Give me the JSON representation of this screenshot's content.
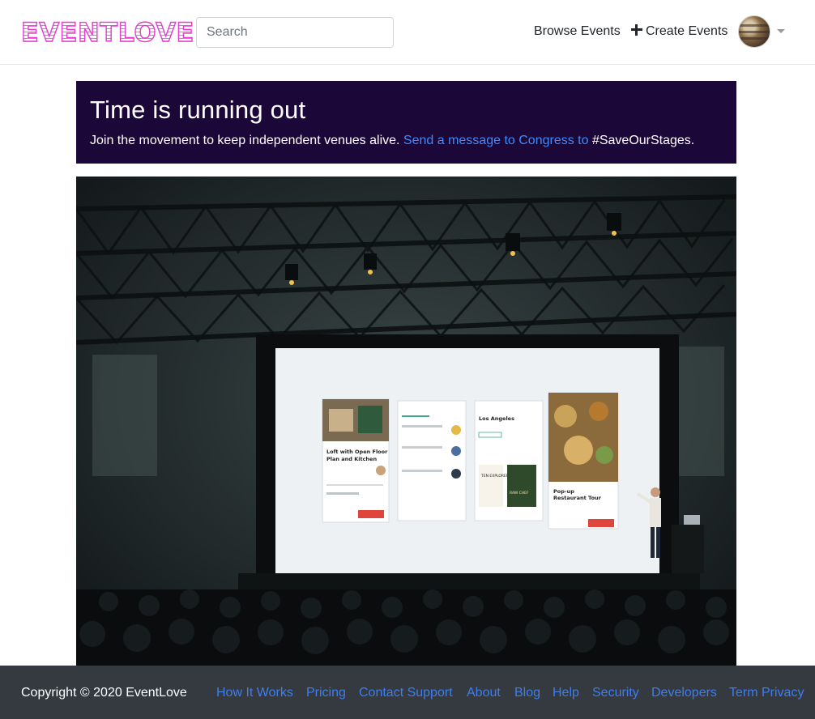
{
  "navbar": {
    "logo_text": "EVENTLOVE",
    "search_placeholder": "Search",
    "browse_label": "Browse Events",
    "create_label": "Create Events"
  },
  "banner": {
    "title": "Time is running out",
    "text_before": "Join the movement to keep independent venues alive. ",
    "link_text": "Send a message to Congress to",
    "text_after": " #SaveOurStages."
  },
  "hero": {
    "screen_cards": {
      "card1_title_line1": "Loft with Open Floor",
      "card1_title_line2": "Plan and Kitchen",
      "card3_title": "Los Angeles",
      "card3_poster1": "TEN EXPLORERS",
      "card3_poster2": "RAW CHEF",
      "card4_title_line1": "Pop-up",
      "card4_title_line2": "Restaurant Tour"
    }
  },
  "footer": {
    "copyright": "Copyright © 2020 EventLove",
    "links": [
      "How It Works",
      "Pricing",
      "Contact Support",
      "About",
      "Blog",
      "Help",
      "Security",
      "Developers",
      "Term Privacy"
    ]
  },
  "colors": {
    "brand": "#e93ad4",
    "banner_bg": "#1c0838",
    "link": "#3d8bfd",
    "footer_bg": "#343a40"
  }
}
